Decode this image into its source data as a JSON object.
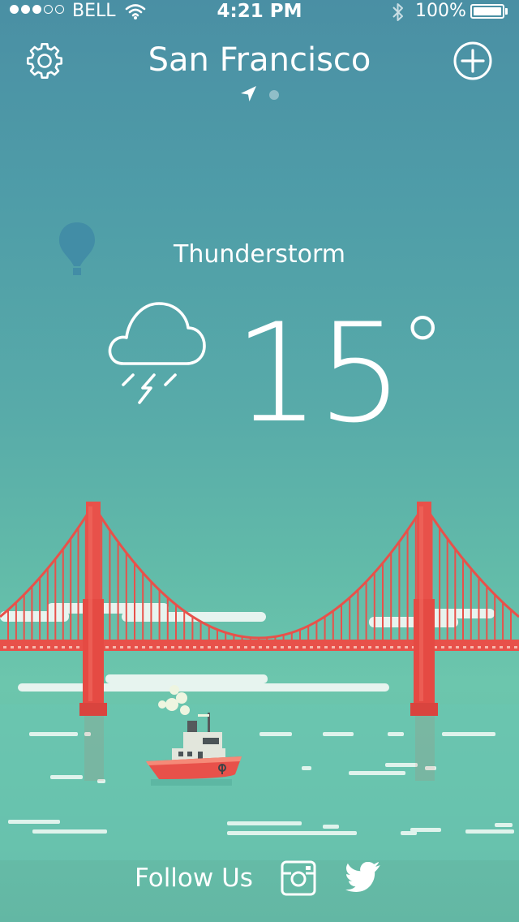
{
  "status_bar": {
    "signal": "●●●○○",
    "carrier": "BELL",
    "time": "4:21 PM",
    "battery": "100%"
  },
  "header": {
    "city": "San Francisco",
    "icons": [
      "gear-icon",
      "add-circle-icon",
      "location-arrow-icon"
    ]
  },
  "weather": {
    "condition": "Thunderstorm",
    "temperature": "15",
    "degree": "°",
    "icon": "cloud-thunderstorm-icon"
  },
  "footer": {
    "follow_label": "Follow Us",
    "icons": [
      "instagram-icon",
      "twitter-icon"
    ]
  },
  "colors": {
    "sky_top": "#4a8fa4",
    "sky_bottom": "#6cc6ad",
    "bridge": "#e8514a",
    "boat": "#e8514a"
  }
}
